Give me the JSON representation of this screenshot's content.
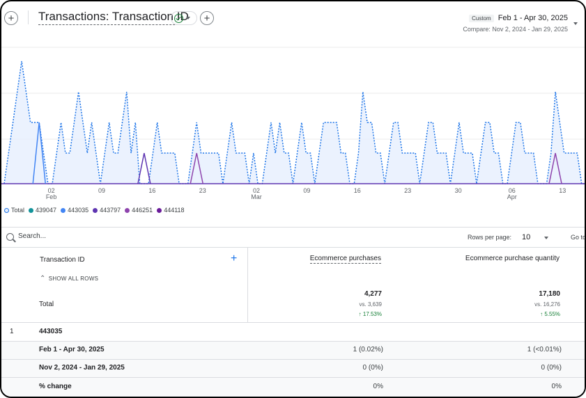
{
  "header": {
    "title": "Transactions: Transaction ID",
    "date_tag": "Custom",
    "date_range": "Feb 1 - Apr 30, 2025",
    "compare": "Compare: Nov 2, 2024 - Jan 29, 2025"
  },
  "chart_data": {
    "type": "line",
    "x_tick_labels": [
      "02",
      "09",
      "16",
      "23",
      "02",
      "09",
      "16",
      "23",
      "30",
      "06",
      "13"
    ],
    "x_month_labels": [
      "Feb",
      "Mar",
      "Apr"
    ],
    "series": [
      {
        "name": "Total",
        "style": "dotted-area",
        "color": "#1a73e8",
        "values": [
          0,
          1,
          2,
          3,
          4,
          3,
          2,
          2,
          2,
          1,
          0,
          0,
          1,
          2,
          1,
          1,
          2,
          3,
          2,
          1,
          2,
          1,
          0,
          1,
          2,
          1,
          1,
          2,
          3,
          1,
          2,
          0,
          0,
          0,
          1,
          2,
          1,
          1,
          1,
          1,
          0,
          0,
          0,
          1,
          2,
          1,
          1,
          1,
          1,
          1,
          0,
          1,
          2,
          1,
          1,
          1,
          0,
          1,
          0,
          0,
          1,
          2,
          1,
          2,
          1,
          1,
          0,
          1,
          2,
          1,
          1,
          0,
          1,
          2,
          2,
          2,
          2,
          1,
          1,
          0,
          0,
          1,
          3,
          2,
          2,
          1,
          1,
          0,
          1,
          2,
          2,
          1,
          1,
          1,
          1,
          0,
          1,
          2,
          2,
          1,
          1,
          1,
          0,
          1,
          2,
          1,
          1,
          1,
          0,
          1,
          2,
          2,
          1,
          1,
          0,
          0,
          1,
          2,
          2,
          1,
          1,
          1,
          0,
          0,
          0,
          1,
          3,
          2,
          1,
          1,
          1,
          1,
          0,
          0
        ]
      },
      {
        "name": "439047",
        "color": "#12939a"
      },
      {
        "name": "443035",
        "color": "#4285f4"
      },
      {
        "name": "443797",
        "color": "#5e35b1"
      },
      {
        "name": "446251",
        "color": "#8e44ad"
      },
      {
        "name": "444118",
        "color": "#6a1b9a"
      }
    ],
    "grid": true
  },
  "legend": [
    {
      "label": "Total",
      "color": "#1a73e8",
      "hollow": true
    },
    {
      "label": "439047",
      "color": "#12939a"
    },
    {
      "label": "443035",
      "color": "#4285f4"
    },
    {
      "label": "443797",
      "color": "#5e35b1"
    },
    {
      "label": "446251",
      "color": "#8e44ad"
    },
    {
      "label": "444118",
      "color": "#6a1b9a"
    }
  ],
  "table": {
    "search_placeholder": "Search...",
    "rows_per_page_label": "Rows per page:",
    "rows_per_page_value": "10",
    "goto_label": "Go to",
    "col_dimension": "Transaction ID",
    "col_metric1": "Ecommerce purchases",
    "col_metric2": "Ecommerce purchase quantity",
    "show_all_rows": "SHOW ALL ROWS",
    "total_label": "Total",
    "total_m1": "4,277",
    "total_m1_vs": "vs. 3,639",
    "total_m1_pct": "↑ 17.53%",
    "total_m2": "17,180",
    "total_m2_vs": "vs. 16,276",
    "total_m2_pct": "↑ 5.55%",
    "rows": [
      {
        "index": "1",
        "id": "443035"
      }
    ],
    "sub_rows": [
      {
        "label": "Feb 1 - Apr 30, 2025",
        "m1": "1 (0.02%)",
        "m2": "1 (<0.01%)"
      },
      {
        "label": "Nov 2, 2024 - Jan 29, 2025",
        "m1": "0 (0%)",
        "m2": "0 (0%)"
      },
      {
        "label": "% change",
        "m1": "0%",
        "m2": "0%"
      }
    ]
  }
}
